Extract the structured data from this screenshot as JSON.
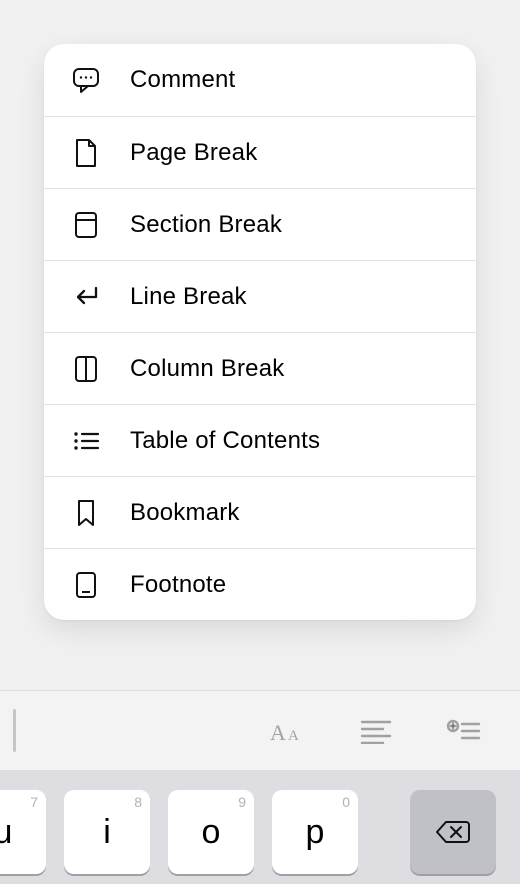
{
  "menu": {
    "items": [
      {
        "id": "comment",
        "label": "Comment",
        "icon": "comment-icon"
      },
      {
        "id": "page-break",
        "label": "Page Break",
        "icon": "page-icon"
      },
      {
        "id": "section-break",
        "label": "Section Break",
        "icon": "section-icon"
      },
      {
        "id": "line-break",
        "label": "Line Break",
        "icon": "return-icon"
      },
      {
        "id": "column-break",
        "label": "Column Break",
        "icon": "columns-icon"
      },
      {
        "id": "table-of-contents",
        "label": "Table of Contents",
        "icon": "list-icon"
      },
      {
        "id": "bookmark",
        "label": "Bookmark",
        "icon": "bookmark-icon"
      },
      {
        "id": "footnote",
        "label": "Footnote",
        "icon": "footnote-icon"
      }
    ]
  },
  "accessory": {
    "text_format_button": "Aa",
    "align_button": "align",
    "insert_button": "insert"
  },
  "keyboard": {
    "keys": [
      {
        "main": "u",
        "hint": "7"
      },
      {
        "main": "i",
        "hint": "8"
      },
      {
        "main": "o",
        "hint": "9"
      },
      {
        "main": "p",
        "hint": "0"
      }
    ],
    "backspace": "⌫"
  }
}
